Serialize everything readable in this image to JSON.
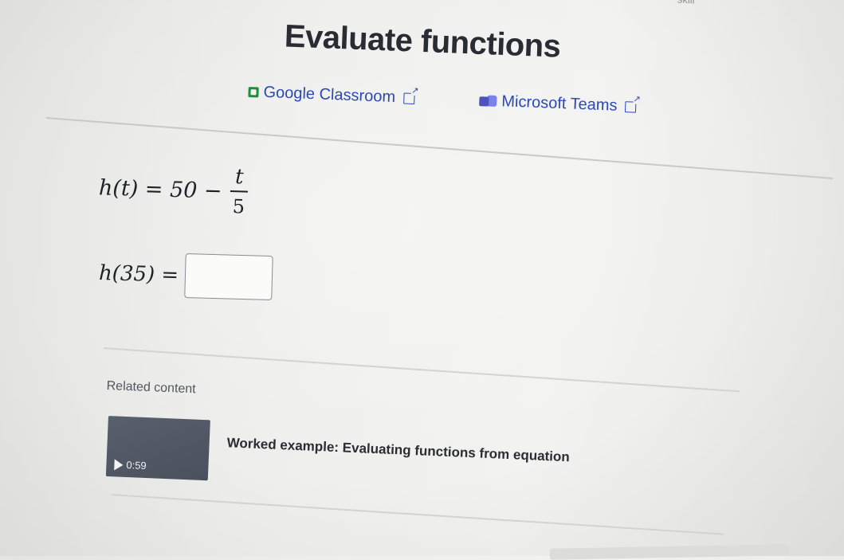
{
  "header": {
    "corner_text": "skill",
    "title": "Evaluate functions"
  },
  "share": {
    "google_classroom": "Google Classroom",
    "microsoft_teams": "Microsoft Teams"
  },
  "problem": {
    "equation_lhs": "h(t) = 50 −",
    "fraction_numerator": "t",
    "fraction_denominator": "5",
    "question_lhs": "h(35) =",
    "answer_value": ""
  },
  "related": {
    "label": "Related content",
    "video": {
      "duration": "0:59",
      "title": "Worked example: Evaluating functions from equation"
    }
  },
  "colors": {
    "link": "#2c47b8",
    "google_green": "#1e8e3e",
    "teams_purple": "#4b53bc",
    "thumbnail": "#555b67"
  }
}
